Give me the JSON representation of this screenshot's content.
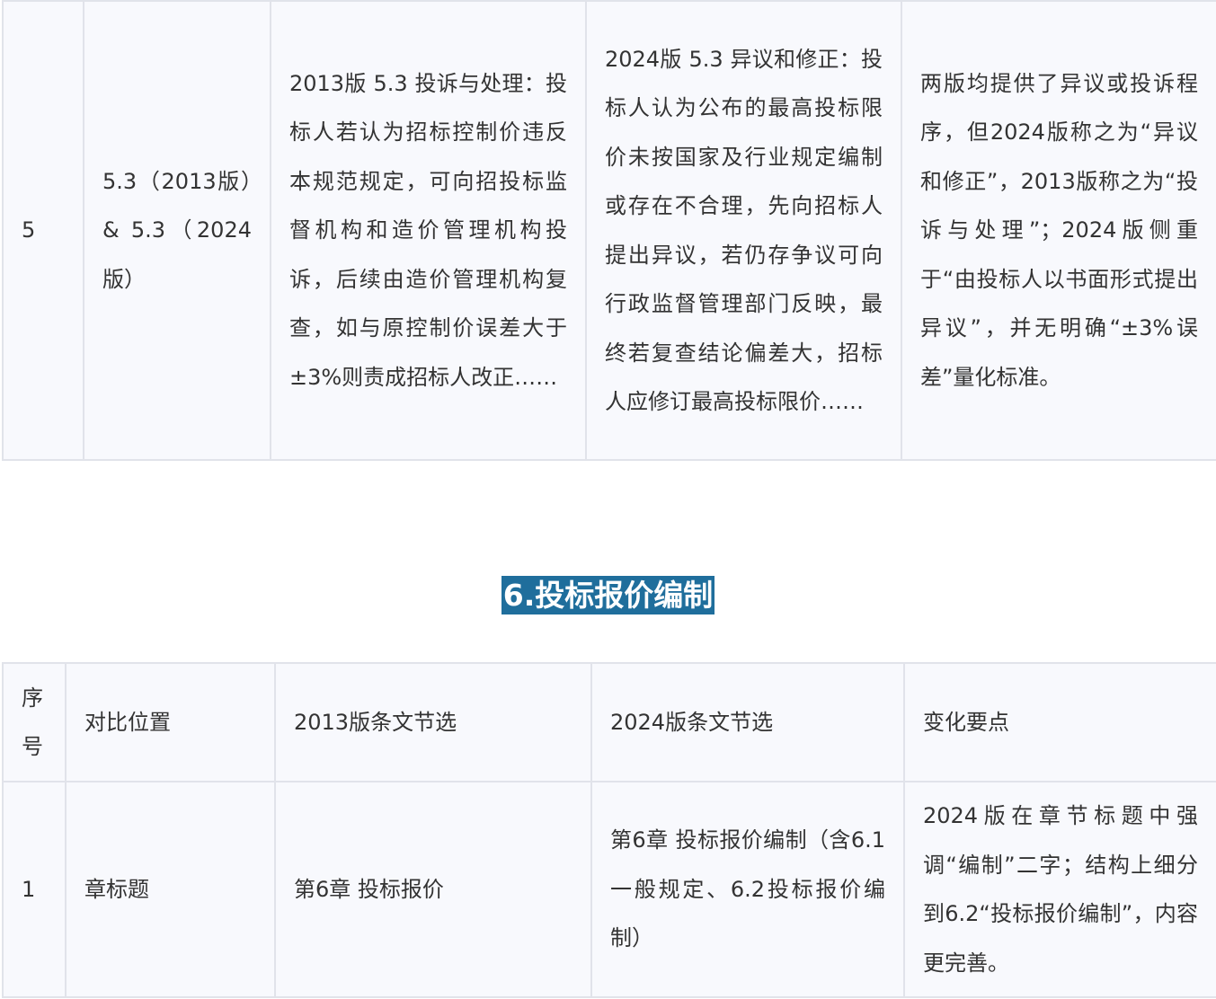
{
  "table_top": {
    "rows": [
      {
        "no": "5",
        "position": "5.3（2013版）& 5.3（2024版）",
        "text_2013": "2013版 5.3 投诉与处理：投标人若认为招标控制价违反本规范规定，可向招投标监督机构和造价管理机构投诉，后续由造价管理机构复查，如与原控制价误差大于±3%则责成招标人改正……",
        "text_2024": "2024版 5.3 异议和修正：投标人认为公布的最高投标限价未按国家及行业规定编制或存在不合理，先向招标人提出异议，若仍存争议可向行政监督管理部门反映，最终若复查结论偏差大，招标人应修订最高投标限价……",
        "change": "两版均提供了异议或投诉程序，但2024版称之为“异议和修正”，2013版称之为“投诉与处理”；2024版侧重于“由投标人以书面形式提出异议”，并无明确“±3%误差”量化标准。"
      }
    ]
  },
  "section_heading": "6.投标报价编制",
  "table_bottom": {
    "headers": [
      "序号",
      "对比位置",
      "2013版条文节选",
      "2024版条文节选",
      "变化要点"
    ],
    "rows": [
      {
        "no": "1",
        "position": "章标题",
        "text_2013": "第6章 投标报价",
        "text_2024": "第6章 投标报价编制（含6.1一般规定、6.2投标报价编制）",
        "change": "2024版在章节标题中强调“编制”二字；结构上细分到6.2“投标报价编制”，内容更完善。"
      }
    ]
  },
  "colors": {
    "heading_bg": "#1f6e9c",
    "table_bg": "#f8f9fd",
    "border": "#e1e3ea"
  }
}
